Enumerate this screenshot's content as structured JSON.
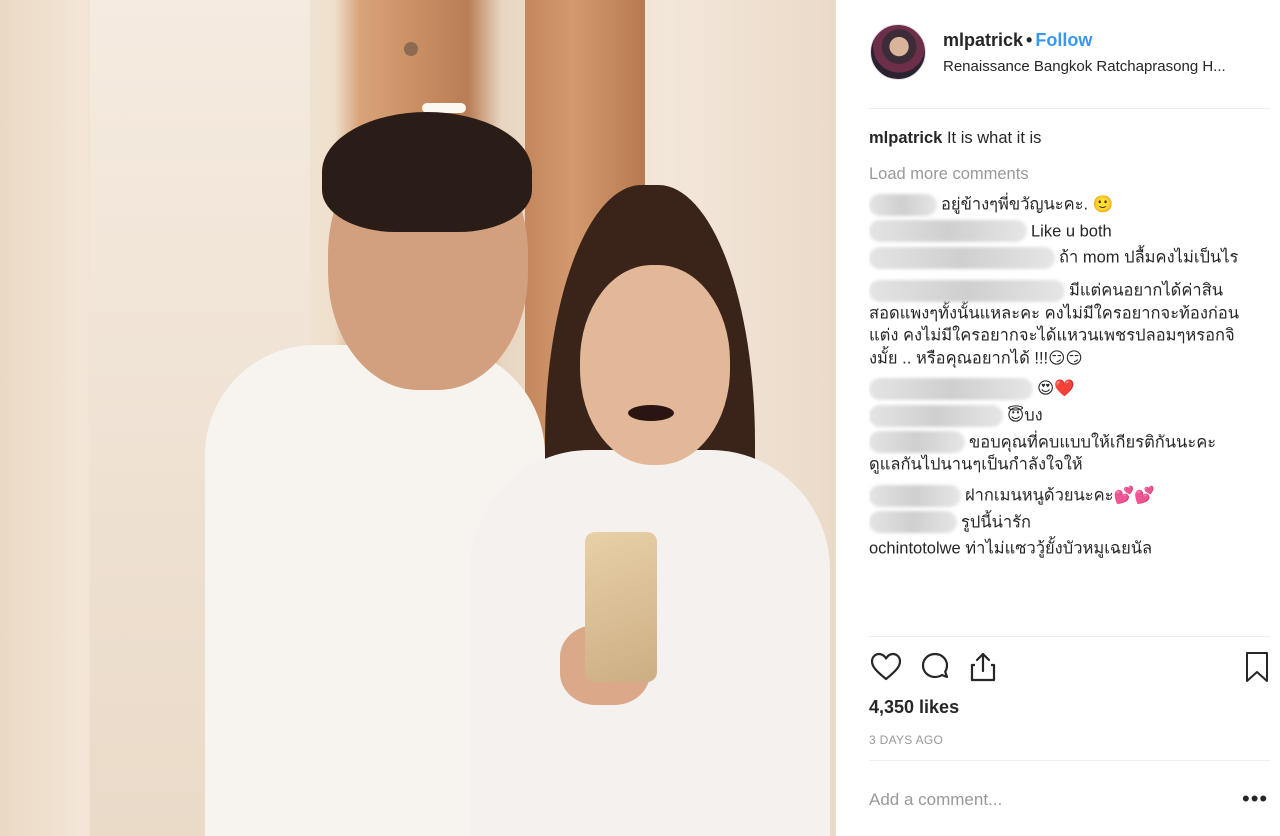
{
  "post": {
    "username": "mlpatrick",
    "separator": "•",
    "follow_label": "Follow",
    "location": "Renaissance Bangkok Ratchaprasong H...",
    "caption_user": "mlpatrick",
    "caption_text": "It is what it is"
  },
  "comments_section": {
    "load_more_label": "Load more comments",
    "items": [
      {
        "text": "อยู่ข้างๆพี่ขวัญนะคะ. 🙂"
      },
      {
        "text": "Like u both"
      },
      {
        "text": "ถ้า mom ปลื้มคงไม่เป็นไร"
      },
      {
        "text": "มีแต่คนอยากได้ค่าสินสอดแพงๆทั้งนั้นแหละคะ คงไม่มีใครอยากจะท้องก่อนแต่ง คงไม่มีใครอยากจะได้แหวนเพชรปลอมๆหรอกจิงมั้ย .. หรือคุณอยากได้ !!!😏😏"
      },
      {
        "text": "😍❤️"
      },
      {
        "text": "😇บง"
      },
      {
        "text": "ขอบคุณที่คบแบบให้เกียรติกันนะคะ ดูแลกันไปนานๆเป็นกำลังใจให้"
      },
      {
        "text": "ฝากเมนหนูด้วยนะคะ💕💕"
      },
      {
        "text": "รูปนี้น่ารัก"
      },
      {
        "text": "ochintotolwe ท่าไม่แซววู้ยั้งบัวหมูเฉยนัล"
      }
    ]
  },
  "stats": {
    "likes": "4,350 likes",
    "time_ago": "3 DAYS AGO"
  },
  "add_comment": {
    "placeholder": "Add a comment...",
    "more_label": "•••"
  },
  "icons": {
    "like": "heart-icon",
    "comment": "comment-icon",
    "share": "share-icon",
    "save": "bookmark-icon"
  }
}
